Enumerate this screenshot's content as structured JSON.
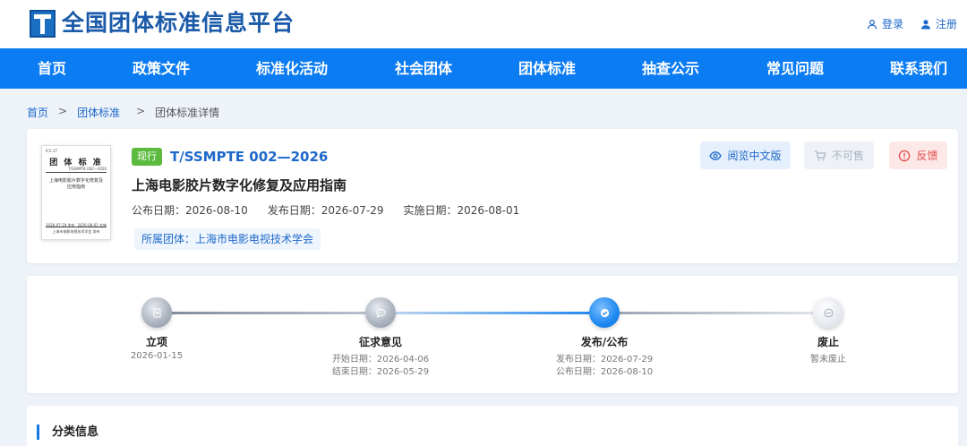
{
  "header": {
    "site_title": "全国团体标准信息平台",
    "login_label": "登录",
    "register_label": "注册"
  },
  "nav": {
    "items": [
      "首页",
      "政策文件",
      "标准化活动",
      "社会团体",
      "团体标准",
      "抽查公示",
      "常见问题",
      "联系我们"
    ]
  },
  "breadcrumb": {
    "items": [
      "首页",
      "团体标准",
      "团体标准详情"
    ],
    "separator": ">"
  },
  "standard": {
    "status": "现行",
    "code": "T/SSMPTE 002—2026",
    "name": "上海电影胶片数字化修复及应用指南",
    "announce_date_label": "公布日期：2026-08-10",
    "publish_date_label": "发布日期：2026-07-29",
    "implement_date_label": "实施日期：2026-08-01",
    "organization_label": "所属团体：上海市电影电视技术学会",
    "thumbnail": {
      "top_text": "ICS 37",
      "title": "团 体 标 准",
      "code": "T/SSMPTE 002—2026",
      "name": "上海电影胶片数字化修复及应用指南",
      "date_left": "2026-07-29 发布",
      "date_right": "2026-08-01 实施",
      "org": "上海市电影电视技术学会 发布"
    }
  },
  "actions": {
    "read_label": "阅览中文版",
    "buy_label": "不可售",
    "feedback_label": "反馈"
  },
  "progress": {
    "steps": [
      {
        "label": "立项",
        "lines": [
          "2026-01-15"
        ]
      },
      {
        "label": "征求意见",
        "lines": [
          "开始日期：2026-04-06",
          "结束日期：2026-05-29"
        ]
      },
      {
        "label": "发布/公布",
        "lines": [
          "发布日期：2026-07-29",
          "公布日期：2026-08-10"
        ]
      },
      {
        "label": "废止",
        "lines": [
          "暂未废止"
        ]
      }
    ]
  },
  "classification": {
    "title": "分类信息"
  },
  "colors": {
    "nav_bg": "#0c7cf2",
    "link": "#1d68c9",
    "status_green": "#5cbb3f",
    "feedback_red": "#e24a4a"
  }
}
